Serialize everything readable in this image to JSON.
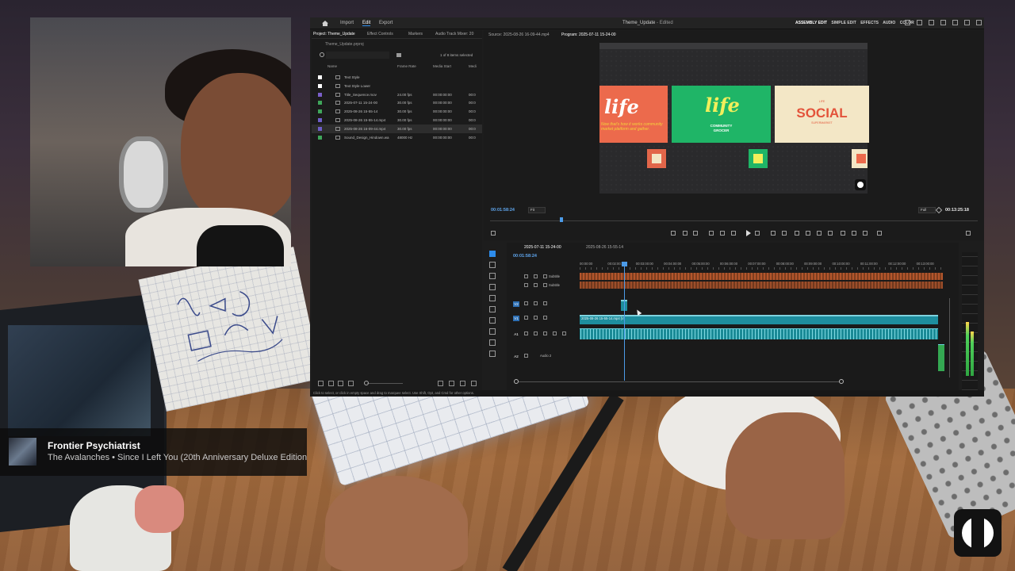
{
  "app": {
    "workspace_tabs": [
      "Import",
      "Edit",
      "Export"
    ],
    "active_workspace": "Edit",
    "title": "Theme_Update",
    "title_status": " - Edited",
    "workspace_modes": [
      "ASSEMBLY EDIT",
      "SIMPLE EDIT",
      "EFFECTS",
      "AUDIO",
      "COLOR"
    ]
  },
  "project_panel": {
    "tabs": [
      "Project: Theme_Update",
      "Effect Controls",
      "Markers",
      "Audio Track Mixer: 20"
    ],
    "project_file": "Theme_Update.prproj",
    "items_count": "1 of 8 items selected",
    "columns": [
      "Name",
      "Frame Rate",
      "Media Start",
      "Medi"
    ],
    "assets": [
      {
        "name": "Text Style",
        "fps": "",
        "start": "",
        "med": "",
        "color": "#ffffff"
      },
      {
        "name": "Text Style Lower",
        "fps": "",
        "start": "",
        "med": "",
        "color": "#ffffff"
      },
      {
        "name": "Title_Sequence.mov",
        "fps": "24.00 fps",
        "start": "00:00:00:00",
        "med": "00:0",
        "color": "#7a5fc9"
      },
      {
        "name": "2025-07-11 15-24-00",
        "fps": "30.00 fps",
        "start": "00:00:00:00",
        "med": "00:0",
        "color": "#3fa65a"
      },
      {
        "name": "2025-08-26 15-55-14",
        "fps": "30.00 fps",
        "start": "00:00:00:00",
        "med": "00:0",
        "color": "#3fa65a"
      },
      {
        "name": "2025-08-26 15-55-14.mp4",
        "fps": "30.00 fps",
        "start": "00:00:00:00",
        "med": "00:0",
        "color": "#6d5ec7"
      },
      {
        "name": "2025-08-26 16-09-44.mp4",
        "fps": "30.00 fps",
        "start": "00:00:00:00",
        "med": "00:0",
        "color": "#6d5ec7"
      },
      {
        "name": "Sound_Design_Hindown.wa",
        "fps": "48000 Hz",
        "start": "00:00:00:00",
        "med": "00:0",
        "color": "#3fa65a"
      }
    ]
  },
  "monitors": {
    "source_tab": "Source: 2025-08-26 16-09-44.mp4",
    "program_tab": "Program: 2025-07-11 15-24-00",
    "program_timecode": "00:01:58:24",
    "fit_value": "Fit",
    "full_value": "Full",
    "duration": "00:13:25:18"
  },
  "program_frame": {
    "card1_logo": "life",
    "card1_caption": "Now that's how it works community market platform and gather.",
    "card2_logo": "life",
    "card2_sub1": "COMMUNITY",
    "card2_sub2": "GROCER",
    "card3_top": "LIFE",
    "card3_logo": "SOCIAL",
    "card3_sub": "SUPERMARKET"
  },
  "timeline": {
    "tabs": [
      "2025-07-11 15-24-00",
      "2025-08-26 15-55-14"
    ],
    "timecode": "00:01:58:24",
    "ruler": [
      "00:00:00",
      "00:02:00:00",
      "00:03:00:00",
      "00:04:00:00",
      "00:05:00:00",
      "00:06:00:00",
      "00:07:00:00",
      "00:08:00:00",
      "00:09:00:00",
      "00:10:00:00",
      "00:11:00:00",
      "00:12:00:00",
      "00:13:00:00"
    ],
    "tracks": {
      "sub1": "Subtitle",
      "sub2": "Subtitle",
      "v2": "V2",
      "v1": "V1",
      "a1": "A1",
      "a2": "A2",
      "audio2": "Audio 2"
    },
    "clip_label": "2025-08-26 15-55-14.mp4 [V]"
  },
  "status_text": "Click to select, or click in empty space and drag to marquee select. Use Shift, Opt, and Cmd for other options.",
  "now_playing": {
    "title": "Frontier Psychiatrist",
    "artist": "The Avalanches • Since I Left You (20th Anniversary Deluxe Edition)"
  },
  "colors": {
    "accent_blue": "#2d8ceb",
    "timecode_blue": "#5fa6ee",
    "subtitle_orange": "#b3562c",
    "video_clip_teal": "#1e8e9e",
    "life_red": "#ec6a4c",
    "community_green": "#1fb567",
    "social_cream": "#f3e7c6"
  }
}
